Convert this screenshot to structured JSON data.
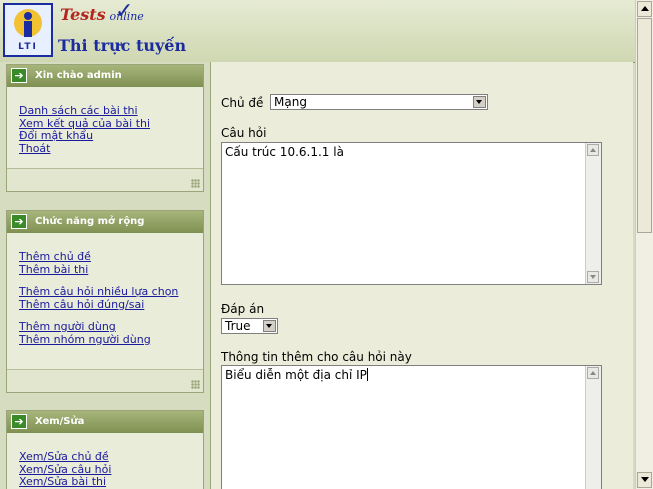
{
  "header": {
    "logo_text": "LTI",
    "brand_tests": "Tests",
    "brand_online": "online",
    "site_title": "Thi trực tuyến"
  },
  "sidebar": {
    "panels": [
      {
        "title": "Xin chào admin",
        "links": [
          "Danh sách các bài thi",
          "Xem kết quả của bài thi",
          "Đổi mật khẩu",
          "Thoát"
        ]
      },
      {
        "title": "Chức năng mở rộng",
        "links": [
          "Thêm chủ đề",
          "Thêm bài thi",
          "Thêm câu hỏi nhiều lựa chọn",
          "Thêm câu hỏi đúng/sai",
          "Thêm người dùng",
          "Thêm nhóm người dùng"
        ]
      },
      {
        "title": "Xem/Sửa",
        "links": [
          "Xem/Sửa chủ đề",
          "Xem/Sửa câu hỏi",
          "Xem/Sửa bài thi"
        ]
      }
    ]
  },
  "form": {
    "topic_label": "Chủ đề",
    "topic_value": "Mạng",
    "question_label": "Câu hỏi",
    "question_value": "Cấu trúc 10.6.1.1 là",
    "answer_label": "Đáp án",
    "answer_value": "True",
    "extra_label": "Thông tin thêm cho câu hỏi này",
    "extra_value": "Biểu diễn một địa chỉ IP"
  },
  "colors": {
    "panel_header": "#7f9152",
    "link": "#1a1a9c",
    "brand_blue": "#1b2ba0",
    "brand_red": "#b3261e"
  }
}
